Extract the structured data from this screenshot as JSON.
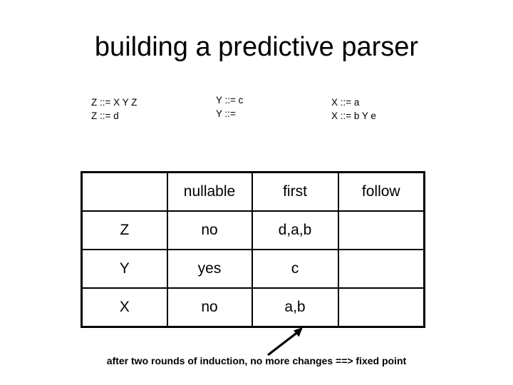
{
  "slide": {
    "title": "building a predictive parser",
    "background_color": "#ffffff",
    "text_color": "#000000"
  },
  "grammar": {
    "groups": [
      {
        "name": "Z",
        "rules": [
          "Z ::= X Y Z",
          "Z ::= d"
        ]
      },
      {
        "name": "Y",
        "rules": [
          "Y ::= c",
          "Y ::="
        ]
      },
      {
        "name": "X",
        "rules": [
          "X ::= a",
          "X ::= b Y e"
        ]
      }
    ]
  },
  "table": {
    "headers": [
      "",
      "nullable",
      "first",
      "follow"
    ],
    "rows": [
      {
        "symbol": "Z",
        "nullable": "no",
        "first": "d,a,b",
        "follow": ""
      },
      {
        "symbol": "Y",
        "nullable": "yes",
        "first": "c",
        "follow": ""
      },
      {
        "symbol": "X",
        "nullable": "no",
        "first": "a,b",
        "follow": ""
      }
    ]
  },
  "annotation": {
    "arrow": "arrow-up-right",
    "caption": "after two rounds of induction, no more changes ==> fixed point"
  }
}
